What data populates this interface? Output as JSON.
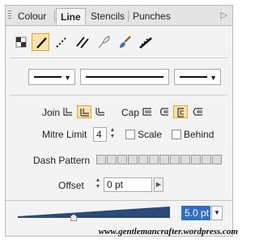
{
  "tabs": [
    {
      "label": "Colour"
    },
    {
      "label": "Line"
    },
    {
      "label": "Stencils"
    },
    {
      "label": "Punches"
    }
  ],
  "tools": [
    "no-line-icon",
    "solid-line-icon",
    "dotted-line-icon",
    "double-line-icon",
    "feather-icon",
    "brush-icon",
    "calligraphy-icon"
  ],
  "join": {
    "label": "Join",
    "options": [
      "miter-join-icon",
      "round-join-icon",
      "bevel-join-icon"
    ],
    "selected_index": 1
  },
  "cap": {
    "label": "Cap",
    "options": [
      "butt-cap-icon",
      "round-cap-icon",
      "square-cap-icon",
      "projecting-cap-icon"
    ],
    "selected_index": 2
  },
  "mitre": {
    "label": "Mitre Limit",
    "value": "4"
  },
  "scale": {
    "label": "Scale",
    "checked": false
  },
  "behind": {
    "label": "Behind",
    "checked": false
  },
  "dash": {
    "label": "Dash Pattern",
    "cells": 12
  },
  "offset": {
    "label": "Offset",
    "value": "0 pt"
  },
  "width": {
    "value": "5.0 pt",
    "slider_fraction": 0.33
  },
  "watermark": "www.gentlemancrafter.wordpress.com",
  "colors": {
    "accent": "#2f6fc0",
    "selected": "#fbe3a7",
    "track": "#2b4a78"
  }
}
